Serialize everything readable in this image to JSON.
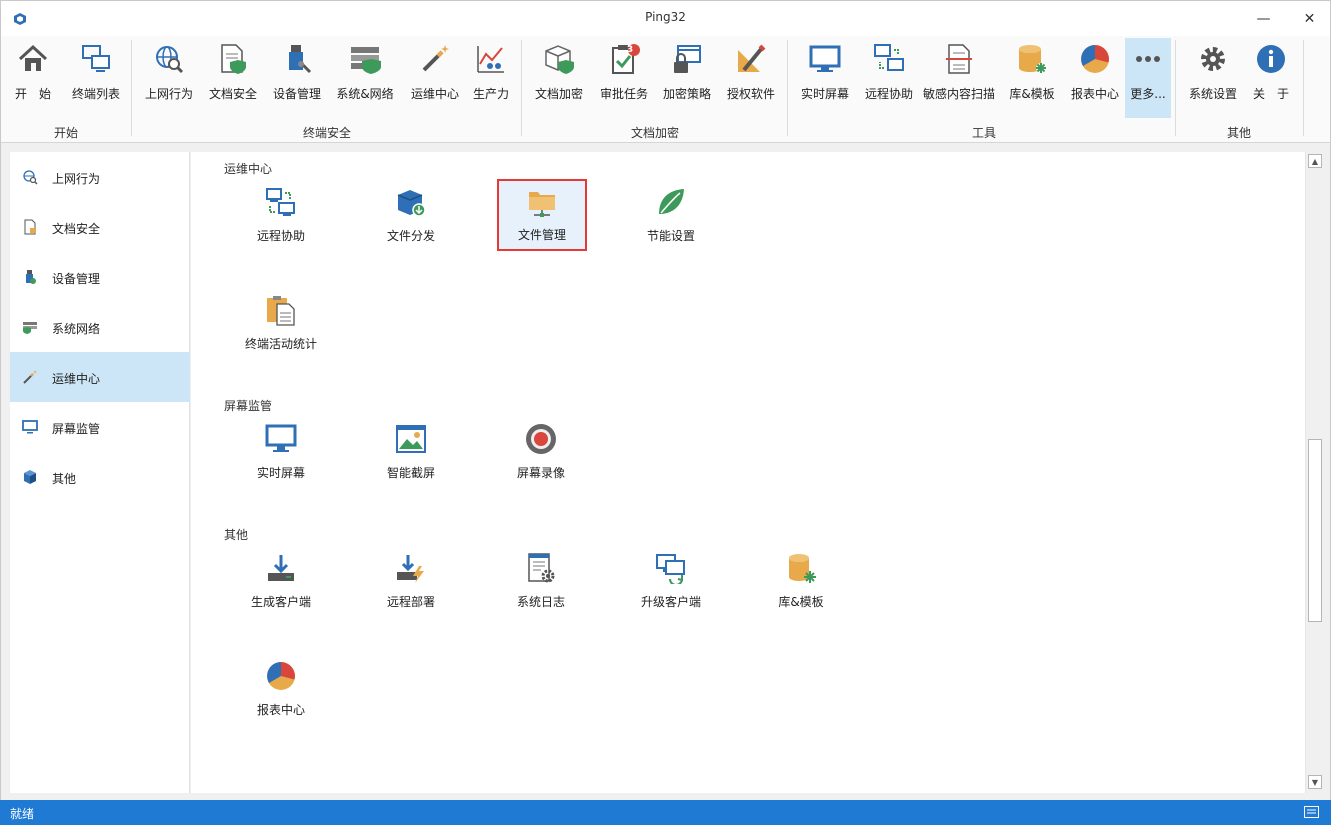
{
  "window": {
    "title": "Ping32",
    "minimize": "—",
    "maximize": "☐",
    "close": "✕"
  },
  "ribbon": {
    "buttons": [
      {
        "label": "开　始",
        "icon": "home-icon"
      },
      {
        "label": "终端列表",
        "icon": "computers-icon"
      },
      {
        "label": "上网行为",
        "icon": "globe-search-icon"
      },
      {
        "label": "文档安全",
        "icon": "document-shield-icon"
      },
      {
        "label": "设备管理",
        "icon": "usb-device-icon"
      },
      {
        "label": "系统&网络",
        "icon": "firewall-icon"
      },
      {
        "label": "运维中心",
        "icon": "magic-wand-icon"
      },
      {
        "label": "生产力",
        "icon": "chart-people-icon"
      },
      {
        "label": "文档加密",
        "icon": "box-shield-icon"
      },
      {
        "label": "审批任务",
        "icon": "clipboard-check-icon"
      },
      {
        "label": "加密策略",
        "icon": "lock-window-icon"
      },
      {
        "label": "授权软件",
        "icon": "ruler-pencil-icon"
      },
      {
        "label": "实时屏幕",
        "icon": "monitor-icon"
      },
      {
        "label": "远程协助",
        "icon": "remote-desktop-icon"
      },
      {
        "label": "敏感内容扫描",
        "icon": "document-scan-icon"
      },
      {
        "label": "库&模板",
        "icon": "database-icon"
      },
      {
        "label": "报表中心",
        "icon": "pie-chart-icon"
      },
      {
        "label": "更多...",
        "icon": "more-dots-icon"
      },
      {
        "label": "系统设置",
        "icon": "gear-icon"
      },
      {
        "label": "关　于",
        "icon": "info-icon"
      }
    ],
    "groups": [
      "开始",
      "终端安全",
      "文档加密",
      "工具",
      "其他"
    ],
    "approval_badge": "3"
  },
  "sidebar": {
    "items": [
      {
        "label": "上网行为",
        "icon": "globe-search-icon"
      },
      {
        "label": "文档安全",
        "icon": "document-lock-icon"
      },
      {
        "label": "设备管理",
        "icon": "usb-device-icon"
      },
      {
        "label": "系统网络",
        "icon": "firewall-icon"
      },
      {
        "label": "运维中心",
        "icon": "magic-wand-icon"
      },
      {
        "label": "屏幕监管",
        "icon": "monitor-icon"
      },
      {
        "label": "其他",
        "icon": "cube-icon"
      }
    ],
    "active_index": 4
  },
  "content": {
    "sections": [
      {
        "title": "运维中心",
        "tiles": [
          {
            "label": "远程协助",
            "icon": "remote-desktop-icon"
          },
          {
            "label": "文件分发",
            "icon": "package-download-icon"
          },
          {
            "label": "文件管理",
            "icon": "folder-network-icon"
          },
          {
            "label": "节能设置",
            "icon": "leaf-icon"
          },
          {
            "label": "终端活动统计",
            "icon": "clipboard-report-icon"
          }
        ]
      },
      {
        "title": "屏幕监管",
        "tiles": [
          {
            "label": "实时屏幕",
            "icon": "monitor-icon"
          },
          {
            "label": "智能截屏",
            "icon": "picture-icon"
          },
          {
            "label": "屏幕录像",
            "icon": "record-icon"
          }
        ]
      },
      {
        "title": "其他",
        "tiles": [
          {
            "label": "生成客户端",
            "icon": "download-tray-icon"
          },
          {
            "label": "远程部署",
            "icon": "download-lightning-icon"
          },
          {
            "label": "系统日志",
            "icon": "log-gear-icon"
          },
          {
            "label": "升级客户端",
            "icon": "monitor-refresh-icon"
          },
          {
            "label": "库&模板",
            "icon": "database-icon"
          },
          {
            "label": "报表中心",
            "icon": "pie-chart-icon"
          }
        ]
      }
    ],
    "selected_tile": "文件管理"
  },
  "status": {
    "text": "就绪"
  },
  "colors": {
    "accent": "#1e7ad3",
    "active_bg": "#cde6f7",
    "selection_border": "#e53935",
    "icon_blue": "#2f6fb5",
    "icon_orange": "#e8a94a",
    "icon_green": "#3d9a5a",
    "icon_red": "#d9463b"
  }
}
